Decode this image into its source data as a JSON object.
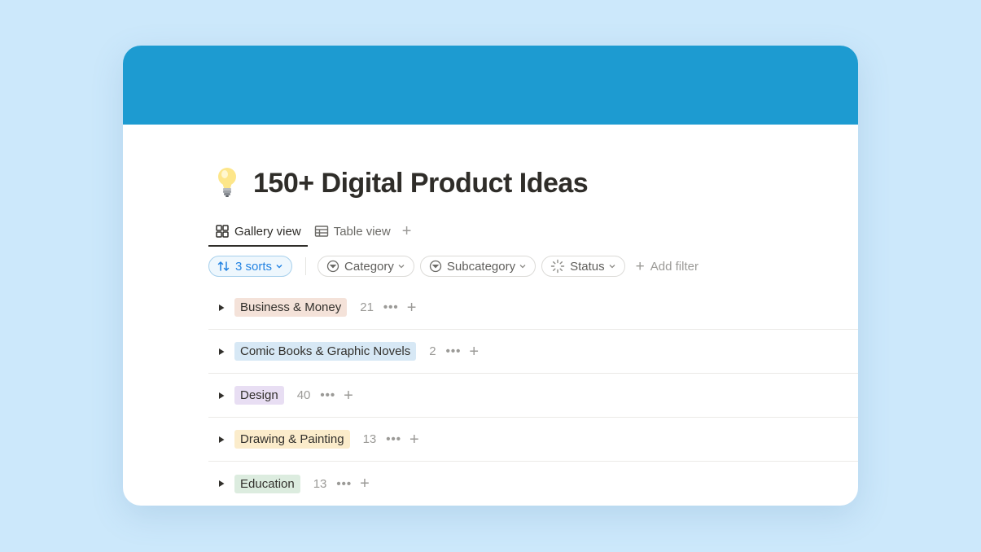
{
  "page": {
    "title": "150+ Digital Product Ideas",
    "icon": "lightbulb-icon"
  },
  "colors": {
    "background": "#cce8fb",
    "cover": "#1d9bd1",
    "accent": "#2383e2"
  },
  "tabs": [
    {
      "label": "Gallery view",
      "icon": "gallery-icon",
      "active": true
    },
    {
      "label": "Table view",
      "icon": "table-icon",
      "active": false
    }
  ],
  "filters": {
    "sorts_label": "3 sorts",
    "category_label": "Category",
    "subcategory_label": "Subcategory",
    "status_label": "Status",
    "add_filter_label": "Add filter"
  },
  "groups": [
    {
      "label": "Business & Money",
      "count": "21",
      "color": "#f4e2d9"
    },
    {
      "label": "Comic Books & Graphic Novels",
      "count": "2",
      "color": "#d7e8f5"
    },
    {
      "label": "Design",
      "count": "40",
      "color": "#e8def3"
    },
    {
      "label": "Drawing & Painting",
      "count": "13",
      "color": "#fbeccb"
    },
    {
      "label": "Education",
      "count": "13",
      "color": "#dcecdf"
    }
  ]
}
